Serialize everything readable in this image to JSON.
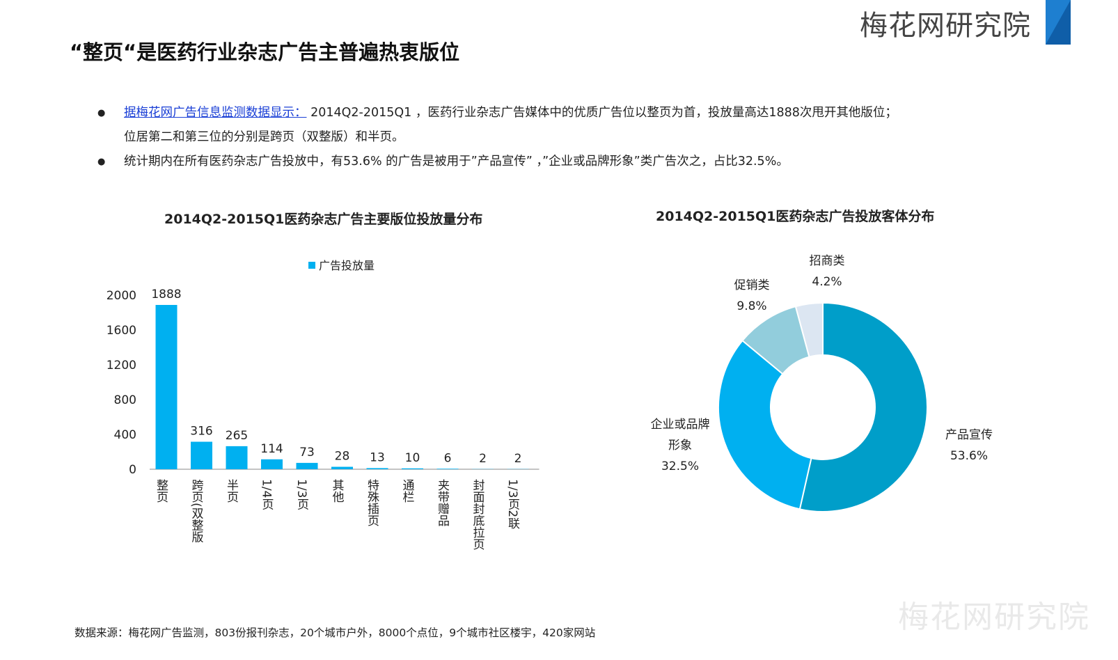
{
  "header": {
    "brand": "梅花网研究院",
    "title": "“整页“是医药行业杂志广告主普遍热衷版位"
  },
  "bullets": [
    {
      "link": "据梅花网广告信息监测数据显示：",
      "text1": " 2014Q2-2015Q1 ，医药行业杂志广告媒体中的优质广告位以整页为首，投放量高达1888次甩开其他版位；",
      "text2": "位居第二和第三位的分别是跨页（双整版）和半页。"
    },
    {
      "text1": "统计期内在所有医药杂志广告投放中，有53.6% 的广告是被用于”产品宣传” ，”企业或品牌形象”类广告次之，占比32.5%。"
    }
  ],
  "chart_data": [
    {
      "type": "bar",
      "title": "2014Q2-2015Q1医药杂志广告主要版位投放量分布",
      "legend": "广告投放量",
      "categories": [
        "整页",
        "跨页(双整版",
        "半页",
        "1/4页",
        "1/3页",
        "其他",
        "特殊插页",
        "通栏",
        "夹带赠品",
        "封面封底拉页",
        "1/3页2联"
      ],
      "values": [
        1888,
        316,
        265,
        114,
        73,
        28,
        13,
        10,
        6,
        2,
        2
      ],
      "yticks": [
        0,
        400,
        800,
        1200,
        1600,
        2000
      ],
      "ylim": [
        0,
        2000
      ],
      "color": "#00b0f0"
    },
    {
      "type": "pie",
      "title": "2014Q2-2015Q1医药杂志广告投放客体分布",
      "slices": [
        {
          "label": "产品宣传",
          "value": 53.6,
          "display": "53.6%",
          "color": "#009ec9"
        },
        {
          "label": "企业或品牌形象",
          "value": 32.5,
          "display": "32.5%",
          "color": "#00b0f0"
        },
        {
          "label": "促销类",
          "value": 9.8,
          "display": "9.8%",
          "color": "#92cddc"
        },
        {
          "label": "招商类",
          "value": 4.2,
          "display": "4.2%",
          "color": "#dce6f2"
        }
      ]
    }
  ],
  "footer": {
    "source": "数据来源：梅花网广告监测，803份报刊杂志，20个城市户外，8000个点位，9个城市社区楼宇，420家网站",
    "watermark": "梅花网研究院"
  }
}
